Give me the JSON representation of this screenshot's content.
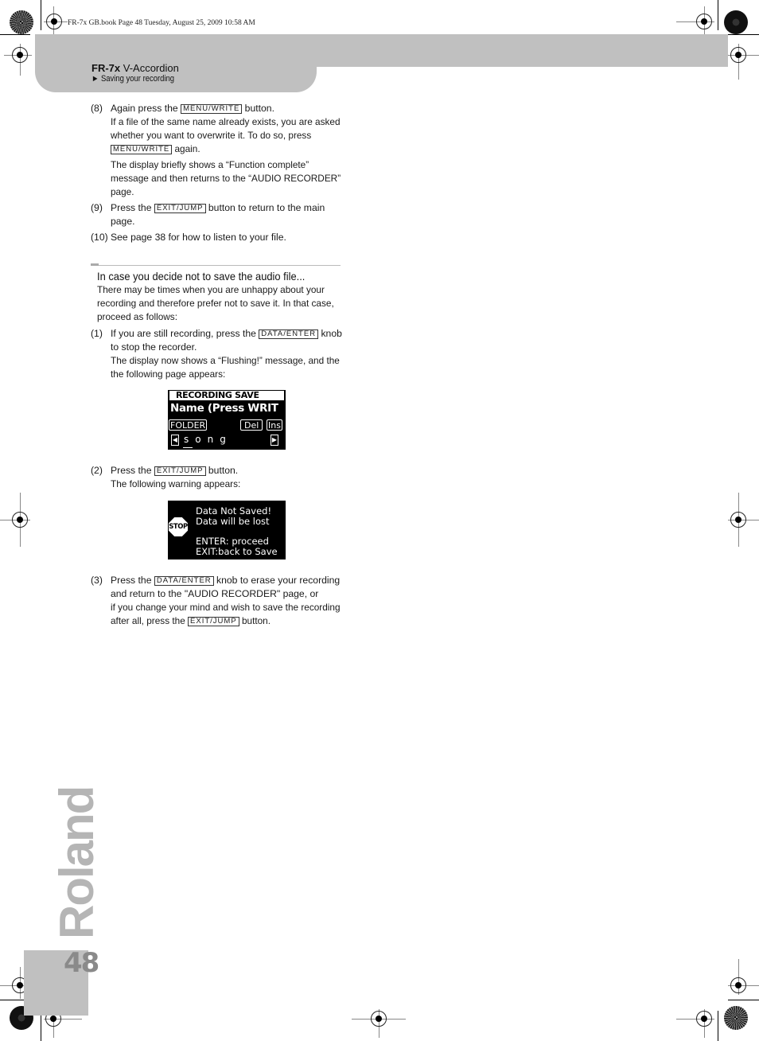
{
  "file_info": "FR-7x GB.book  Page 48  Tuesday, August 25, 2009  10:58 AM",
  "header": {
    "model": "FR-7x",
    "product": " V-Accordion",
    "section": "► Saving your recording"
  },
  "steps_top": [
    {
      "num": "(8)",
      "line_pre": "Again press the ",
      "key": "MENU/WRITE",
      "line_post": " button.",
      "sub1_pre": "If a file of the same name already exists, you are asked whether you want to overwrite it. To do so, press ",
      "sub1_key": "MENU/WRITE",
      "sub1_post": " again.",
      "sub2": "The display briefly shows a “Function complete” message and then returns to the “AUDIO RECORDER” page."
    },
    {
      "num": "(9)",
      "line_pre": "Press the ",
      "key": "EXIT/JUMP",
      "line_post": " button to return to the main page."
    },
    {
      "num": "(10)",
      "text": "See page 38 for how to listen to your file."
    }
  ],
  "section": {
    "title": "In case you decide not to save the audio file...",
    "intro": "There may be times when you are unhappy about your recording and therefore prefer not to save it. In that case, proceed as follows:"
  },
  "steps_bottom": [
    {
      "num": "(1)",
      "line_pre": "If you are still recording, press the ",
      "key": "DATA/ENTER",
      "line_post": " knob to stop the recorder.",
      "sub": "The display now shows a “Flushing!” message, and the the following page appears:"
    },
    {
      "num": "(2)",
      "line_pre": "Press the ",
      "key": "EXIT/JUMP",
      "line_post": " button.",
      "sub": "The following warning appears:"
    },
    {
      "num": "(3)",
      "line_pre": "Press the ",
      "key": "DATA/ENTER",
      "line_post": " knob to erase your recording and return to the \"AUDIO RECORDER\" page, or",
      "sub_pre": "if you change your mind and wish to save the recording after all, press the ",
      "sub_key": "EXIT/JUMP",
      "sub_post": " button."
    }
  ],
  "lcd_save": {
    "title": "RECORDING SAVE",
    "name_line": "Name (Press WRIT",
    "folder": "FOLDER",
    "del": "Del",
    "ins": "Ins",
    "left_arrow": "◀",
    "right_arrow": "▶",
    "value": "song"
  },
  "lcd_warning": {
    "stop": "STOP",
    "line1": "Data Not Saved!",
    "line2": "Data will be lost",
    "line3": "ENTER: proceed",
    "line4": "EXIT:back to Save"
  },
  "brand": "Roland",
  "page_number": "48"
}
